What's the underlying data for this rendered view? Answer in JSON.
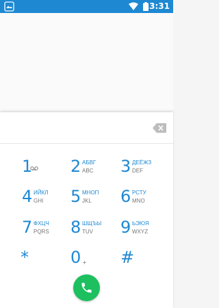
{
  "status_bar": {
    "time": "13:31"
  },
  "digits": {
    "value": ""
  },
  "keypad": {
    "keys": [
      {
        "num": "1",
        "letters": "",
        "latin": ""
      },
      {
        "num": "2",
        "letters": "АБВГ",
        "latin": "ABC"
      },
      {
        "num": "3",
        "letters": "ДЕЁЖЗ",
        "latin": "DEF"
      },
      {
        "num": "4",
        "letters": "ИЙКЛ",
        "latin": "GHI"
      },
      {
        "num": "5",
        "letters": "МНОП",
        "latin": "JKL"
      },
      {
        "num": "6",
        "letters": "РСТУ",
        "latin": "MNO"
      },
      {
        "num": "7",
        "letters": "ФХЦЧ",
        "latin": "PQRS"
      },
      {
        "num": "8",
        "letters": "ШЩЪЫ",
        "latin": "TUV"
      },
      {
        "num": "9",
        "letters": "ЬЭЮЯ",
        "latin": "WXYZ"
      },
      {
        "num": "*",
        "letters": "",
        "latin": ""
      },
      {
        "num": "0",
        "letters": "",
        "latin": "+"
      },
      {
        "num": "#",
        "letters": "",
        "latin": ""
      }
    ]
  },
  "icons": {
    "notification": "notification-icon",
    "wifi": "wifi-icon",
    "battery": "battery-icon",
    "voicemail": "voicemail-icon",
    "backspace": "backspace-icon",
    "call": "phone-icon"
  },
  "colors": {
    "status_bar": "#1e88d2",
    "accent": "#1e88d2",
    "call_button": "#1dbf5f"
  }
}
